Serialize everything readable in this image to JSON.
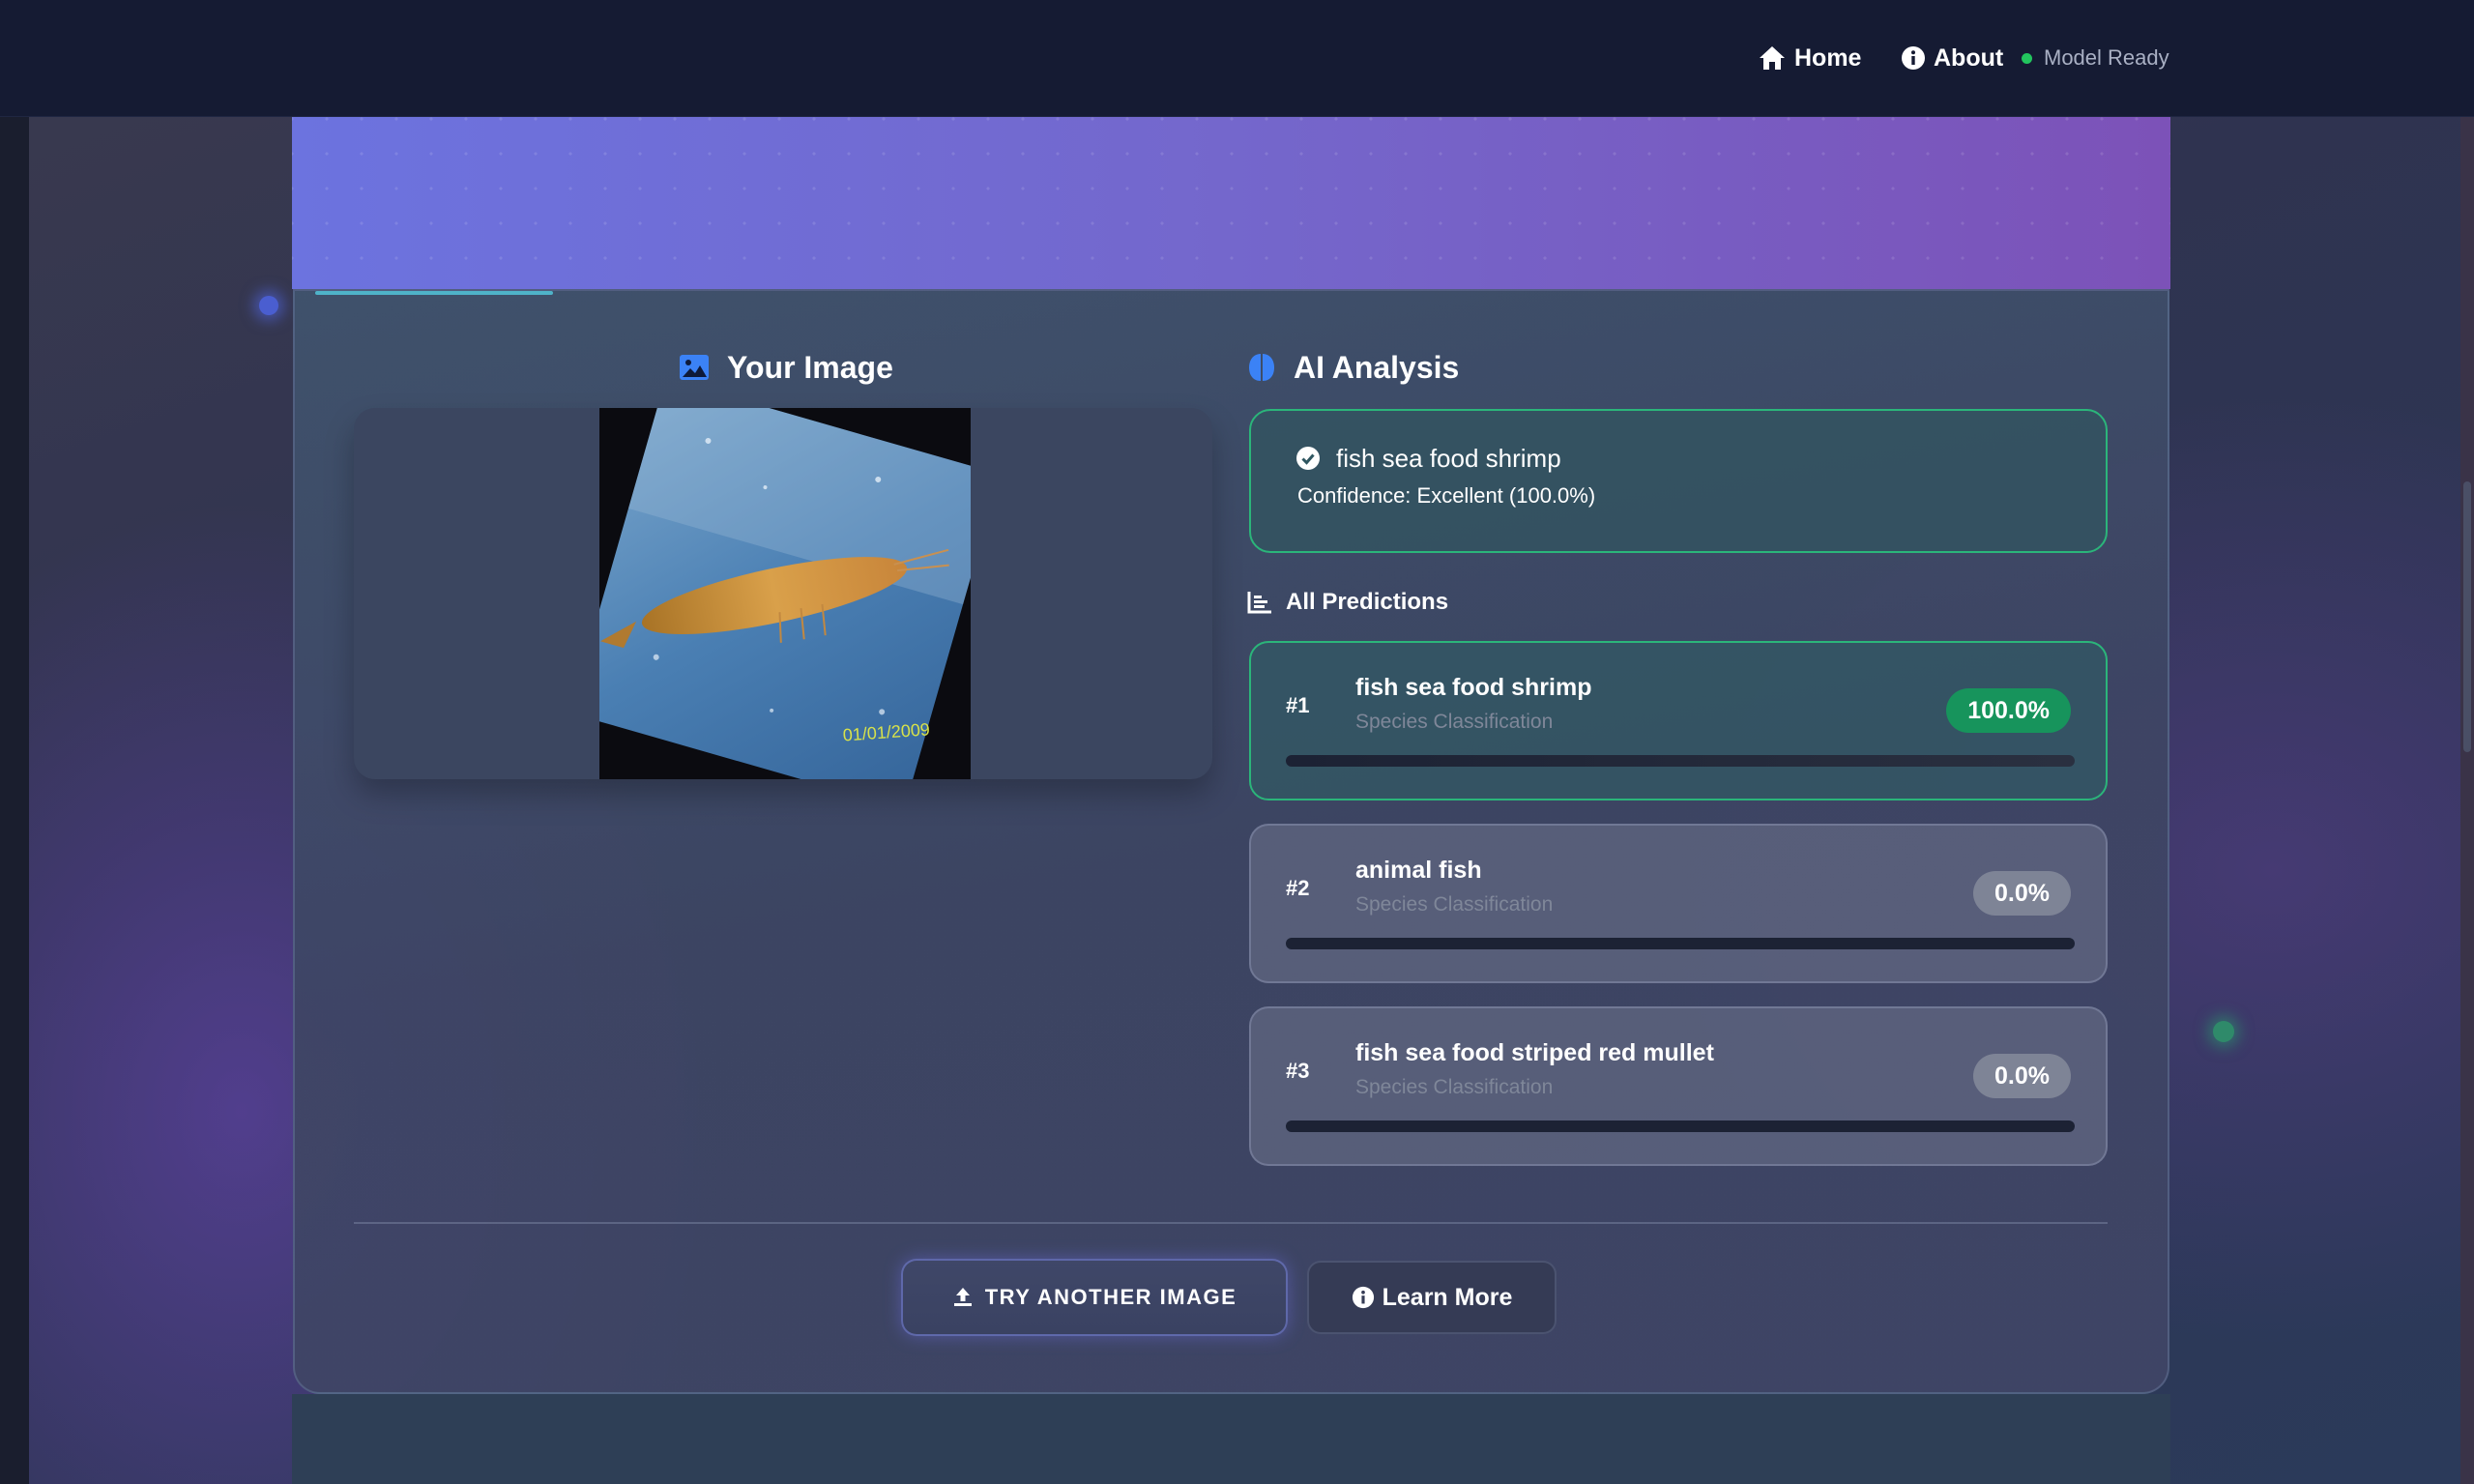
{
  "nav": {
    "home_label": "Home",
    "about_label": "About",
    "status_label": "Model Ready",
    "home_icon": "home-icon",
    "about_icon": "info-circle-icon",
    "status_color": "#22c55e"
  },
  "image_section": {
    "title": "Your Image",
    "icon": "image-icon",
    "photo_timestamp": "01/01/2009"
  },
  "analysis": {
    "title": "AI Analysis",
    "icon": "brain-icon",
    "top_result": {
      "label": "fish sea food shrimp",
      "confidence_text": "Confidence: Excellent (100.0%)",
      "icon": "check-circle-icon"
    },
    "predictions_title": "All Predictions",
    "predictions_icon": "bar-chart-icon",
    "predictions": [
      {
        "rank": "#1",
        "name": "fish sea food shrimp",
        "subtitle": "Species Classification",
        "percent_label": "100.0%",
        "value": 100.0
      },
      {
        "rank": "#2",
        "name": "animal fish",
        "subtitle": "Species Classification",
        "percent_label": "0.0%",
        "value": 0.0
      },
      {
        "rank": "#3",
        "name": "fish sea food striped red mullet",
        "subtitle": "Species Classification",
        "percent_label": "0.0%",
        "value": 0.0
      }
    ]
  },
  "actions": {
    "try_label": "TRY ANOTHER IMAGE",
    "try_icon": "upload-icon",
    "learn_label": "Learn More",
    "learn_icon": "info-circle-icon"
  },
  "colors": {
    "accent_green": "#2bb57a",
    "badge_green": "#17945c",
    "hero_start": "#6c73df",
    "hero_end": "#7c52b8",
    "nav_bg": "#151b33"
  }
}
